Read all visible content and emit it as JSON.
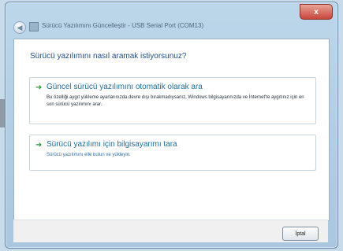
{
  "window": {
    "title": "Sürücü Yazılımını Güncelleştir - USB Serial Port (COM13)",
    "close_label": "x"
  },
  "icons": {
    "back": "back-arrow-icon",
    "app": "device-icon",
    "option_arrow": "green-arrow-icon"
  },
  "main": {
    "question": "Sürücü yazılımını nasıl aramak istiyorsunuz?",
    "options": [
      {
        "title": "Güncel sürücü yazılımını otomatik olarak ara",
        "description": "Bu özelliği aygıt yükleme ayarlarınızda devre dışı bırakmadıysanız, Windows bilgisayarınızda ve İnternet'te aygıtınız için en son sürücü yazılımını arar."
      },
      {
        "title": "Sürücü yazılımı için bilgisayarımı tara",
        "description": "Sürücü yazılımını elle bulun ve yükleyin."
      }
    ]
  },
  "footer": {
    "cancel_label": "İptal"
  },
  "colors": {
    "accent": "#1d6e9c",
    "close": "#c9463a",
    "arrow": "#2e9a3c"
  }
}
